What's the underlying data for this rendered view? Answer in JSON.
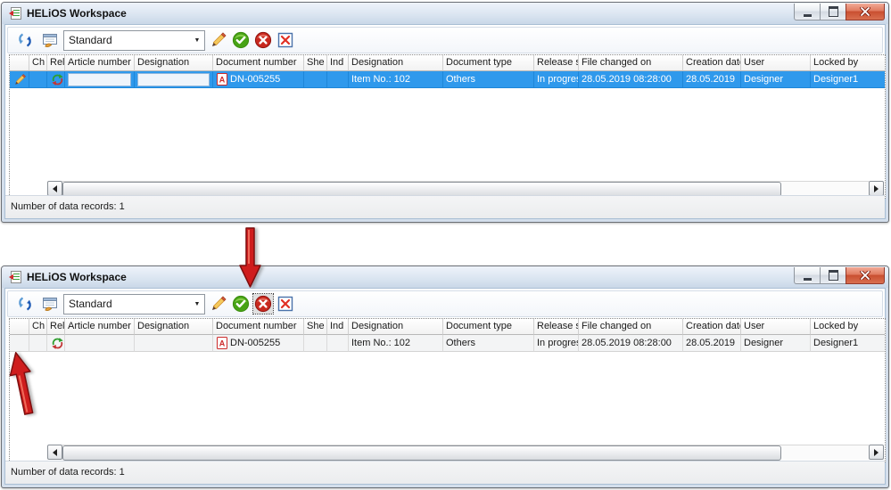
{
  "colors": {
    "selection_blue": "#2f99ec",
    "annotation_red": "#cf1d1d",
    "close_button_red": "#c94f30"
  },
  "windows": [
    {
      "title": "HELiOS Workspace",
      "toolbar": {
        "view_select_value": "Standard"
      },
      "table": {
        "headers": [
          "",
          "Ch",
          "Rel",
          "Article number",
          "Designation",
          "Document number",
          "She",
          "Ind",
          "Designation",
          "Document type",
          "Release st",
          "File changed on",
          "Creation date",
          "User",
          "Locked by"
        ],
        "row": {
          "ch": "",
          "article_number": "",
          "designation": "",
          "document_number": "DN-005255",
          "sheet": "",
          "index": "",
          "designation2": "Item No.: 102",
          "document_type": "Others",
          "release_status": "In progres",
          "file_changed_on": "28.05.2019 08:28:00",
          "creation_date": "28.05.2019",
          "user": "Designer",
          "locked_by": "Designer1"
        }
      },
      "status_text": "Number of data records: 1"
    },
    {
      "title": "HELiOS Workspace",
      "toolbar": {
        "view_select_value": "Standard"
      },
      "table": {
        "headers": [
          "",
          "Ch",
          "Rel",
          "Article number",
          "Designation",
          "Document number",
          "She",
          "Ind",
          "Designation",
          "Document type",
          "Release st",
          "File changed on",
          "Creation date",
          "User",
          "Locked by"
        ],
        "row": {
          "ch": "",
          "article_number": "",
          "designation": "",
          "document_number": "DN-005255",
          "sheet": "",
          "index": "",
          "designation2": "Item No.: 102",
          "document_type": "Others",
          "release_status": "In progres",
          "file_changed_on": "28.05.2019 08:28:00",
          "creation_date": "28.05.2019",
          "user": "Designer",
          "locked_by": "Designer1"
        }
      },
      "status_text": "Number of data records: 1"
    }
  ]
}
